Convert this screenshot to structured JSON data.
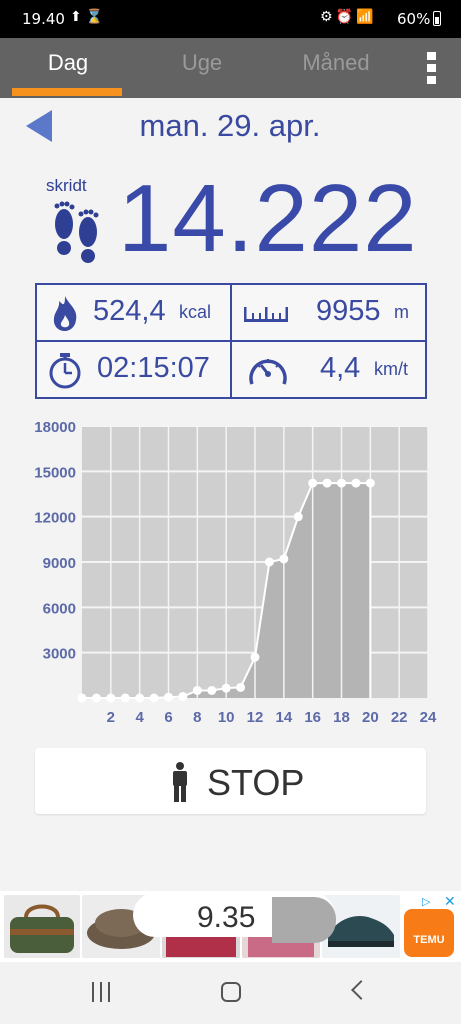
{
  "status_bar": {
    "time": "19.40",
    "battery": "60%"
  },
  "tabs": [
    {
      "label": "Dag",
      "active": true
    },
    {
      "label": "Uge",
      "active": false
    },
    {
      "label": "Måned",
      "active": false
    }
  ],
  "date": "man. 29. apr.",
  "steps": {
    "label": "skridt",
    "value": "14.222"
  },
  "stats": {
    "calories": {
      "value": "524,4",
      "unit": "kcal"
    },
    "distance": {
      "value": "9955",
      "unit": "m"
    },
    "duration": {
      "value": "02:15:07"
    },
    "speed": {
      "value": "4,4",
      "unit": "km/t"
    }
  },
  "chart_data": {
    "type": "area",
    "ylim": [
      0,
      18000
    ],
    "xlim": [
      0,
      24
    ],
    "yticks": [
      "3000",
      "6000",
      "9000",
      "12000",
      "15000",
      "18000"
    ],
    "xticks": [
      "2",
      "4",
      "6",
      "8",
      "10",
      "12",
      "14",
      "16",
      "18",
      "20",
      "22",
      "24"
    ],
    "x": [
      0,
      1,
      2,
      3,
      4,
      5,
      6,
      7,
      8,
      9,
      10,
      11,
      12,
      13,
      14,
      15,
      16,
      17,
      18,
      19,
      20
    ],
    "values": [
      0,
      0,
      0,
      0,
      0,
      0,
      50,
      100,
      500,
      500,
      650,
      700,
      2700,
      9000,
      9200,
      12000,
      14222,
      14222,
      14222,
      14222,
      14222
    ],
    "grid": true
  },
  "stop_button": {
    "label": "STOP"
  },
  "ad": {
    "price": "9.35",
    "brand": "TEMU"
  },
  "colors": {
    "accent": "#3a4aa0",
    "tab_indicator": "#f7921e",
    "chart_bg": "#cccccc"
  }
}
